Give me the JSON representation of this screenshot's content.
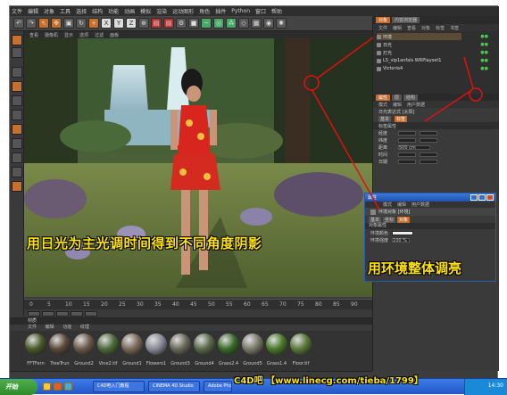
{
  "menubar": {
    "items": [
      "文件",
      "编辑",
      "对象",
      "工具",
      "选择",
      "结构",
      "功能",
      "动画",
      "模拟",
      "渲染",
      "运动图形",
      "角色",
      "插件",
      "Python",
      "窗口",
      "帮助"
    ]
  },
  "viewport": {
    "menu": [
      "查看",
      "摄像机",
      "显示",
      "选项",
      "过滤",
      "面板"
    ]
  },
  "captions": {
    "main": "用日光为主光调时间得到不同角度阴影",
    "side": "用环境整体调亮"
  },
  "timeline": {
    "ticks": [
      "0",
      "5",
      "10",
      "15",
      "20",
      "25",
      "30",
      "35",
      "40",
      "45",
      "50",
      "55",
      "60",
      "65",
      "70",
      "75",
      "80",
      "85",
      "90"
    ]
  },
  "materials": {
    "title": "材质",
    "menu": [
      "文件",
      "编辑",
      "功能",
      "纹理"
    ],
    "items": [
      {
        "name": "FFTFern",
        "color": "#4a5a2a"
      },
      {
        "name": "TreeTrun",
        "color": "#5a4a3a"
      },
      {
        "name": "Ground2",
        "color": "#6a5a4a"
      },
      {
        "name": "Vine2.tif",
        "color": "#4f6a3a"
      },
      {
        "name": "Ground1",
        "color": "#7a6a5a"
      },
      {
        "name": "Flowers1",
        "color": "#8a8a9a"
      },
      {
        "name": "Ground3",
        "color": "#6a6a5a"
      },
      {
        "name": "Ground4",
        "color": "#5a6a4a"
      },
      {
        "name": "Grass2.4",
        "color": "#3a6a2a"
      },
      {
        "name": "Ground5",
        "color": "#7a7a6a"
      },
      {
        "name": "Grass1.4",
        "color": "#4a7a2a"
      },
      {
        "name": "Floor.tif",
        "color": "#5a7a3a"
      }
    ]
  },
  "objects": {
    "tabs": [
      "对象",
      "内容浏览器"
    ],
    "menu": [
      "文件",
      "编辑",
      "查看",
      "对象",
      "标签",
      "书签"
    ],
    "rows": [
      "环境",
      "日光",
      "灯光",
      "LS_vip1anfals WRPlayset1",
      "Victoria4"
    ]
  },
  "attributes": {
    "tabs": [
      "属性",
      "层",
      "结构"
    ],
    "menu": [
      "模式",
      "编辑",
      "用户数据"
    ],
    "title": "日光表达式 [太阳]",
    "section_tabs": [
      "基本",
      "标签"
    ],
    "section": "标签属性",
    "rows": [
      "经度",
      "纬度",
      "距离",
      "时间",
      "日期"
    ],
    "time_value": "500 cm"
  },
  "subwindow": {
    "title": "属性",
    "menu": [
      "模式",
      "编辑",
      "用户数据"
    ],
    "header": "环境对象 [环境]",
    "tabs": [
      "基本",
      "坐标",
      "对象"
    ],
    "section": "对象属性",
    "rows": [
      "环境颜色",
      "环境强度"
    ],
    "intensity": "100 %"
  },
  "taskbar": {
    "start": "开始",
    "tasks": [
      "C4D吧入门教程",
      "CINEMA 4D Studio",
      "Adobe Photoshop"
    ],
    "clock": "14:30"
  },
  "watermark": "C4D吧 【www.linecg.com/tieba/1799】"
}
